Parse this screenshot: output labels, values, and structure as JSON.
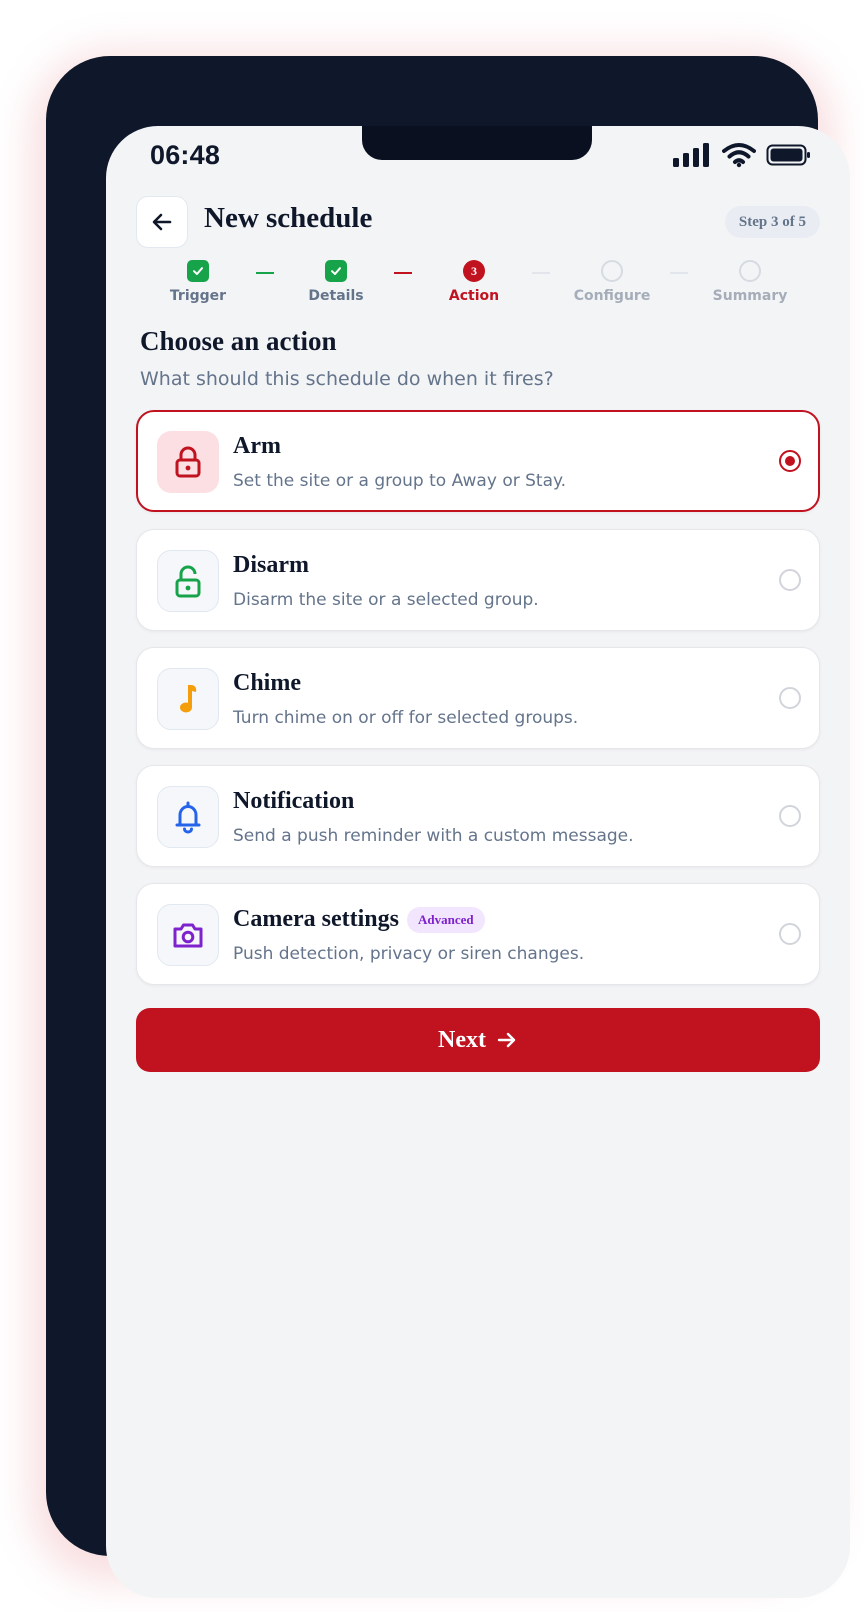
{
  "status_bar": {
    "time": "06:48"
  },
  "header": {
    "title": "New schedule",
    "step_indicator": "Step 3 of 5",
    "back_icon": "arrow-left-icon"
  },
  "stepper": {
    "steps": [
      {
        "label": "Trigger",
        "state": "done",
        "icon": "check-icon"
      },
      {
        "label": "Details",
        "state": "done",
        "icon": "check-icon"
      },
      {
        "label": "Action",
        "state": "current",
        "number": "3"
      },
      {
        "label": "Configure",
        "state": "todo"
      },
      {
        "label": "Summary",
        "state": "todo"
      }
    ]
  },
  "section": {
    "title": "Choose an action",
    "subtitle": "What should this schedule do when it fires?"
  },
  "options": [
    {
      "title": "Arm",
      "description": "Set the site or a group to Away or Stay.",
      "icon": "lock-icon",
      "selected": true,
      "color": "#c1121f"
    },
    {
      "title": "Disarm",
      "description": "Disarm the site or a selected group.",
      "icon": "unlock-icon",
      "selected": false,
      "color": "#16a34a"
    },
    {
      "title": "Chime",
      "description": "Turn chime on or off for selected groups.",
      "icon": "music-note-icon",
      "selected": false,
      "color": "#f59e0b"
    },
    {
      "title": "Notification",
      "description": "Send a push reminder with a custom message.",
      "icon": "bell-icon",
      "selected": false,
      "color": "#2563eb"
    },
    {
      "title": "Camera settings",
      "badge": "Advanced",
      "description": "Push detection, privacy or siren changes.",
      "icon": "camera-icon",
      "selected": false,
      "color": "#7e22ce"
    }
  ],
  "footer": {
    "next_label": "Next",
    "next_icon": "arrow-right-icon"
  },
  "colors": {
    "accent": "#c1121f",
    "success": "#16a34a",
    "background": "#f3f4f6"
  }
}
